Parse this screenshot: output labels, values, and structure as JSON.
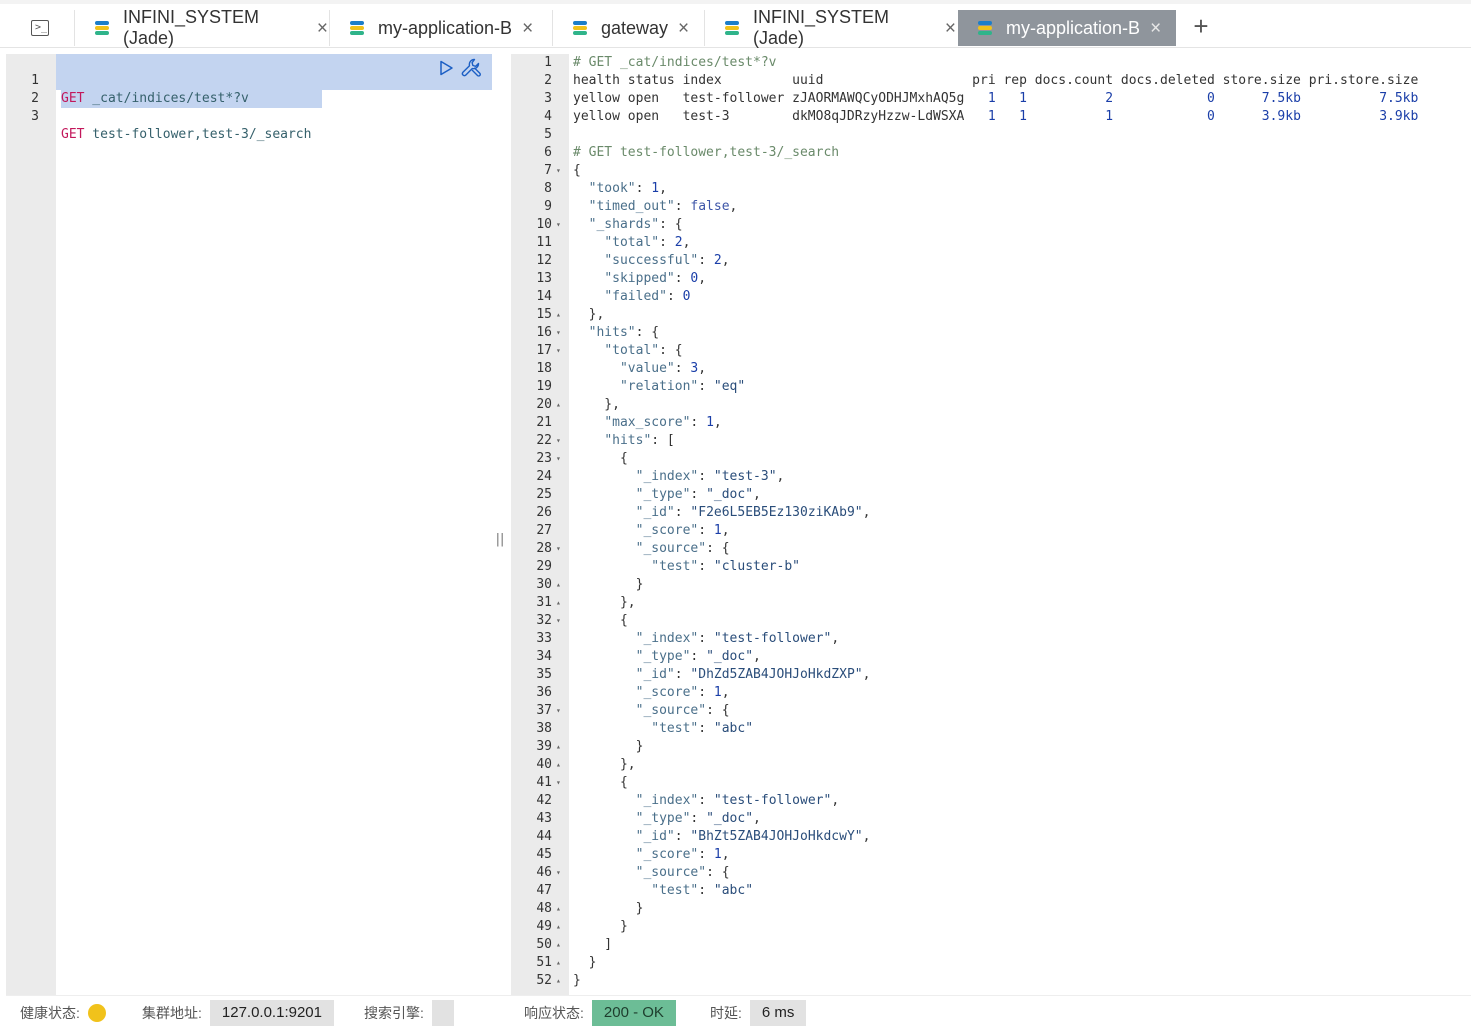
{
  "tabs": [
    {
      "label": "INFINI_SYSTEM (Jade)",
      "close": "×",
      "active": false
    },
    {
      "label": "my-application-B",
      "close": "×",
      "active": false
    },
    {
      "label": "gateway",
      "close": "×",
      "active": false
    },
    {
      "label": "INFINI_SYSTEM (Jade)",
      "close": "×",
      "active": false
    },
    {
      "label": "my-application-B",
      "close": "×",
      "active": true
    }
  ],
  "add_tab": "+",
  "request_editor": {
    "lines": [
      {
        "n": "1",
        "method": "GET",
        "path": " _cat/indices/test*?v"
      },
      {
        "n": "2",
        "method": "",
        "path": ""
      },
      {
        "n": "3",
        "method": "GET",
        "path": " test-follower,test-3/_search"
      }
    ]
  },
  "splitter": "||",
  "response": {
    "lines": [
      {
        "n": "1",
        "fold": "",
        "t": [
          [
            "comment",
            "# GET _cat/indices/test*?v"
          ]
        ]
      },
      {
        "n": "2",
        "fold": "",
        "t": [
          [
            "pun",
            "health status index         uuid                   pri rep docs.count docs.deleted store.size pri.store.size"
          ]
        ]
      },
      {
        "n": "3",
        "fold": "",
        "t": [
          [
            "pun",
            "yellow open   test-follower zJAORMAWQCyODHJMxhAQ5g  "
          ],
          [
            "num",
            " 1   1          2            0"
          ],
          [
            "pun",
            "      "
          ],
          [
            "num",
            "7.5kb"
          ],
          [
            "pun",
            "          "
          ],
          [
            "num",
            "7.5kb"
          ]
        ]
      },
      {
        "n": "4",
        "fold": "",
        "t": [
          [
            "pun",
            "yellow open   test-3        dkMO8qJDRzyHzzw-LdWSXA  "
          ],
          [
            "num",
            " 1   1          1            0"
          ],
          [
            "pun",
            "      "
          ],
          [
            "num",
            "3.9kb"
          ],
          [
            "pun",
            "          "
          ],
          [
            "num",
            "3.9kb"
          ]
        ]
      },
      {
        "n": "5",
        "fold": "",
        "t": []
      },
      {
        "n": "6",
        "fold": "",
        "t": [
          [
            "comment",
            "# GET test-follower,test-3/_search"
          ]
        ]
      },
      {
        "n": "7",
        "fold": "▾",
        "t": [
          [
            "pun",
            "{"
          ]
        ]
      },
      {
        "n": "8",
        "fold": "",
        "t": [
          [
            "pun",
            "  "
          ],
          [
            "key",
            "\"took\""
          ],
          [
            "pun",
            ": "
          ],
          [
            "num",
            "1"
          ],
          [
            "pun",
            ","
          ]
        ]
      },
      {
        "n": "9",
        "fold": "",
        "t": [
          [
            "pun",
            "  "
          ],
          [
            "key",
            "\"timed_out\""
          ],
          [
            "pun",
            ": "
          ],
          [
            "bool",
            "false"
          ],
          [
            "pun",
            ","
          ]
        ]
      },
      {
        "n": "10",
        "fold": "▾",
        "t": [
          [
            "pun",
            "  "
          ],
          [
            "key",
            "\"_shards\""
          ],
          [
            "pun",
            ": {"
          ]
        ]
      },
      {
        "n": "11",
        "fold": "",
        "t": [
          [
            "pun",
            "    "
          ],
          [
            "key",
            "\"total\""
          ],
          [
            "pun",
            ": "
          ],
          [
            "num",
            "2"
          ],
          [
            "pun",
            ","
          ]
        ]
      },
      {
        "n": "12",
        "fold": "",
        "t": [
          [
            "pun",
            "    "
          ],
          [
            "key",
            "\"successful\""
          ],
          [
            "pun",
            ": "
          ],
          [
            "num",
            "2"
          ],
          [
            "pun",
            ","
          ]
        ]
      },
      {
        "n": "13",
        "fold": "",
        "t": [
          [
            "pun",
            "    "
          ],
          [
            "key",
            "\"skipped\""
          ],
          [
            "pun",
            ": "
          ],
          [
            "num",
            "0"
          ],
          [
            "pun",
            ","
          ]
        ]
      },
      {
        "n": "14",
        "fold": "",
        "t": [
          [
            "pun",
            "    "
          ],
          [
            "key",
            "\"failed\""
          ],
          [
            "pun",
            ": "
          ],
          [
            "num",
            "0"
          ]
        ]
      },
      {
        "n": "15",
        "fold": "▴",
        "t": [
          [
            "pun",
            "  },"
          ]
        ]
      },
      {
        "n": "16",
        "fold": "▾",
        "t": [
          [
            "pun",
            "  "
          ],
          [
            "key",
            "\"hits\""
          ],
          [
            "pun",
            ": {"
          ]
        ]
      },
      {
        "n": "17",
        "fold": "▾",
        "t": [
          [
            "pun",
            "    "
          ],
          [
            "key",
            "\"total\""
          ],
          [
            "pun",
            ": {"
          ]
        ]
      },
      {
        "n": "18",
        "fold": "",
        "t": [
          [
            "pun",
            "      "
          ],
          [
            "key",
            "\"value\""
          ],
          [
            "pun",
            ": "
          ],
          [
            "num",
            "3"
          ],
          [
            "pun",
            ","
          ]
        ]
      },
      {
        "n": "19",
        "fold": "",
        "t": [
          [
            "pun",
            "      "
          ],
          [
            "key",
            "\"relation\""
          ],
          [
            "pun",
            ": "
          ],
          [
            "str",
            "\"eq\""
          ]
        ]
      },
      {
        "n": "20",
        "fold": "▴",
        "t": [
          [
            "pun",
            "    },"
          ]
        ]
      },
      {
        "n": "21",
        "fold": "",
        "t": [
          [
            "pun",
            "    "
          ],
          [
            "key",
            "\"max_score\""
          ],
          [
            "pun",
            ": "
          ],
          [
            "num",
            "1"
          ],
          [
            "pun",
            ","
          ]
        ]
      },
      {
        "n": "22",
        "fold": "▾",
        "t": [
          [
            "pun",
            "    "
          ],
          [
            "key",
            "\"hits\""
          ],
          [
            "pun",
            ": ["
          ]
        ]
      },
      {
        "n": "23",
        "fold": "▾",
        "t": [
          [
            "pun",
            "      {"
          ]
        ]
      },
      {
        "n": "24",
        "fold": "",
        "t": [
          [
            "pun",
            "        "
          ],
          [
            "key",
            "\"_index\""
          ],
          [
            "pun",
            ": "
          ],
          [
            "str",
            "\"test-3\""
          ],
          [
            "pun",
            ","
          ]
        ]
      },
      {
        "n": "25",
        "fold": "",
        "t": [
          [
            "pun",
            "        "
          ],
          [
            "key",
            "\"_type\""
          ],
          [
            "pun",
            ": "
          ],
          [
            "str",
            "\"_doc\""
          ],
          [
            "pun",
            ","
          ]
        ]
      },
      {
        "n": "26",
        "fold": "",
        "t": [
          [
            "pun",
            "        "
          ],
          [
            "key",
            "\"_id\""
          ],
          [
            "pun",
            ": "
          ],
          [
            "str",
            "\"F2e6L5EB5Ez130ziKAb9\""
          ],
          [
            "pun",
            ","
          ]
        ]
      },
      {
        "n": "27",
        "fold": "",
        "t": [
          [
            "pun",
            "        "
          ],
          [
            "key",
            "\"_score\""
          ],
          [
            "pun",
            ": "
          ],
          [
            "num",
            "1"
          ],
          [
            "pun",
            ","
          ]
        ]
      },
      {
        "n": "28",
        "fold": "▾",
        "t": [
          [
            "pun",
            "        "
          ],
          [
            "key",
            "\"_source\""
          ],
          [
            "pun",
            ": {"
          ]
        ]
      },
      {
        "n": "29",
        "fold": "",
        "t": [
          [
            "pun",
            "          "
          ],
          [
            "key",
            "\"test\""
          ],
          [
            "pun",
            ": "
          ],
          [
            "str",
            "\"cluster-b\""
          ]
        ]
      },
      {
        "n": "30",
        "fold": "▴",
        "t": [
          [
            "pun",
            "        }"
          ]
        ]
      },
      {
        "n": "31",
        "fold": "▴",
        "t": [
          [
            "pun",
            "      },"
          ]
        ]
      },
      {
        "n": "32",
        "fold": "▾",
        "t": [
          [
            "pun",
            "      {"
          ]
        ]
      },
      {
        "n": "33",
        "fold": "",
        "t": [
          [
            "pun",
            "        "
          ],
          [
            "key",
            "\"_index\""
          ],
          [
            "pun",
            ": "
          ],
          [
            "str",
            "\"test-follower\""
          ],
          [
            "pun",
            ","
          ]
        ]
      },
      {
        "n": "34",
        "fold": "",
        "t": [
          [
            "pun",
            "        "
          ],
          [
            "key",
            "\"_type\""
          ],
          [
            "pun",
            ": "
          ],
          [
            "str",
            "\"_doc\""
          ],
          [
            "pun",
            ","
          ]
        ]
      },
      {
        "n": "35",
        "fold": "",
        "t": [
          [
            "pun",
            "        "
          ],
          [
            "key",
            "\"_id\""
          ],
          [
            "pun",
            ": "
          ],
          [
            "str",
            "\"DhZd5ZAB4JOHJoHkdZXP\""
          ],
          [
            "pun",
            ","
          ]
        ]
      },
      {
        "n": "36",
        "fold": "",
        "t": [
          [
            "pun",
            "        "
          ],
          [
            "key",
            "\"_score\""
          ],
          [
            "pun",
            ": "
          ],
          [
            "num",
            "1"
          ],
          [
            "pun",
            ","
          ]
        ]
      },
      {
        "n": "37",
        "fold": "▾",
        "t": [
          [
            "pun",
            "        "
          ],
          [
            "key",
            "\"_source\""
          ],
          [
            "pun",
            ": {"
          ]
        ]
      },
      {
        "n": "38",
        "fold": "",
        "t": [
          [
            "pun",
            "          "
          ],
          [
            "key",
            "\"test\""
          ],
          [
            "pun",
            ": "
          ],
          [
            "str",
            "\"abc\""
          ]
        ]
      },
      {
        "n": "39",
        "fold": "▴",
        "t": [
          [
            "pun",
            "        }"
          ]
        ]
      },
      {
        "n": "40",
        "fold": "▴",
        "t": [
          [
            "pun",
            "      },"
          ]
        ]
      },
      {
        "n": "41",
        "fold": "▾",
        "t": [
          [
            "pun",
            "      {"
          ]
        ]
      },
      {
        "n": "42",
        "fold": "",
        "t": [
          [
            "pun",
            "        "
          ],
          [
            "key",
            "\"_index\""
          ],
          [
            "pun",
            ": "
          ],
          [
            "str",
            "\"test-follower\""
          ],
          [
            "pun",
            ","
          ]
        ]
      },
      {
        "n": "43",
        "fold": "",
        "t": [
          [
            "pun",
            "        "
          ],
          [
            "key",
            "\"_type\""
          ],
          [
            "pun",
            ": "
          ],
          [
            "str",
            "\"_doc\""
          ],
          [
            "pun",
            ","
          ]
        ]
      },
      {
        "n": "44",
        "fold": "",
        "t": [
          [
            "pun",
            "        "
          ],
          [
            "key",
            "\"_id\""
          ],
          [
            "pun",
            ": "
          ],
          [
            "str",
            "\"BhZt5ZAB4JOHJoHkdcwY\""
          ],
          [
            "pun",
            ","
          ]
        ]
      },
      {
        "n": "45",
        "fold": "",
        "t": [
          [
            "pun",
            "        "
          ],
          [
            "key",
            "\"_score\""
          ],
          [
            "pun",
            ": "
          ],
          [
            "num",
            "1"
          ],
          [
            "pun",
            ","
          ]
        ]
      },
      {
        "n": "46",
        "fold": "▾",
        "t": [
          [
            "pun",
            "        "
          ],
          [
            "key",
            "\"_source\""
          ],
          [
            "pun",
            ": {"
          ]
        ]
      },
      {
        "n": "47",
        "fold": "",
        "t": [
          [
            "pun",
            "          "
          ],
          [
            "key",
            "\"test\""
          ],
          [
            "pun",
            ": "
          ],
          [
            "str",
            "\"abc\""
          ]
        ]
      },
      {
        "n": "48",
        "fold": "▴",
        "t": [
          [
            "pun",
            "        }"
          ]
        ]
      },
      {
        "n": "49",
        "fold": "▴",
        "t": [
          [
            "pun",
            "      }"
          ]
        ]
      },
      {
        "n": "50",
        "fold": "▴",
        "t": [
          [
            "pun",
            "    ]"
          ]
        ]
      },
      {
        "n": "51",
        "fold": "▴",
        "t": [
          [
            "pun",
            "  }"
          ]
        ]
      },
      {
        "n": "52",
        "fold": "▴",
        "t": [
          [
            "pun",
            "}"
          ]
        ]
      }
    ]
  },
  "status": {
    "health_label": "健康状态:",
    "health_color": "#f1c21b",
    "cluster_label": "集群地址:",
    "cluster_value": "127.0.0.1:9201",
    "engine_label": "搜索引擎:",
    "engine_value": "",
    "response_label": "响应状态:",
    "response_value": "200 - OK",
    "latency_label": "时延:",
    "latency_value": "6 ms"
  },
  "colors": {
    "active_tab": "#8f959c",
    "selection": "#c3d4f0",
    "ok_chip": "#6cbd96"
  }
}
